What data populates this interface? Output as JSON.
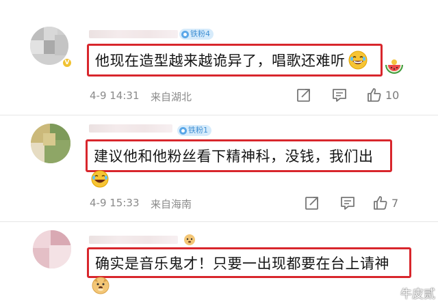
{
  "comments": [
    {
      "badge": "铁粉4",
      "text": "他现在造型越来越诡异了，唱歌还难听",
      "date_time": "4-9 14:31",
      "location": "来自湖北",
      "like_count": "10"
    },
    {
      "badge": "铁粉1",
      "text": "建议他和他粉丝看下精神科，没钱，我们出",
      "date_time": "4-9 15:33",
      "location": "来自海南",
      "like_count": "7"
    },
    {
      "text": "确实是音乐鬼才！只要一出现都要在台上请神"
    }
  ],
  "watermark": "牛皮贰",
  "colors": {
    "highlight_border": "#d8262c",
    "badge_bg": "#d6ebfb",
    "badge_text": "#3f8fd3",
    "meta_text": "#8a8a8a"
  },
  "icons": [
    "share-icon",
    "comment-icon",
    "like-icon",
    "laughing-emoji",
    "watermelon-emoji",
    "dog-emoji"
  ]
}
